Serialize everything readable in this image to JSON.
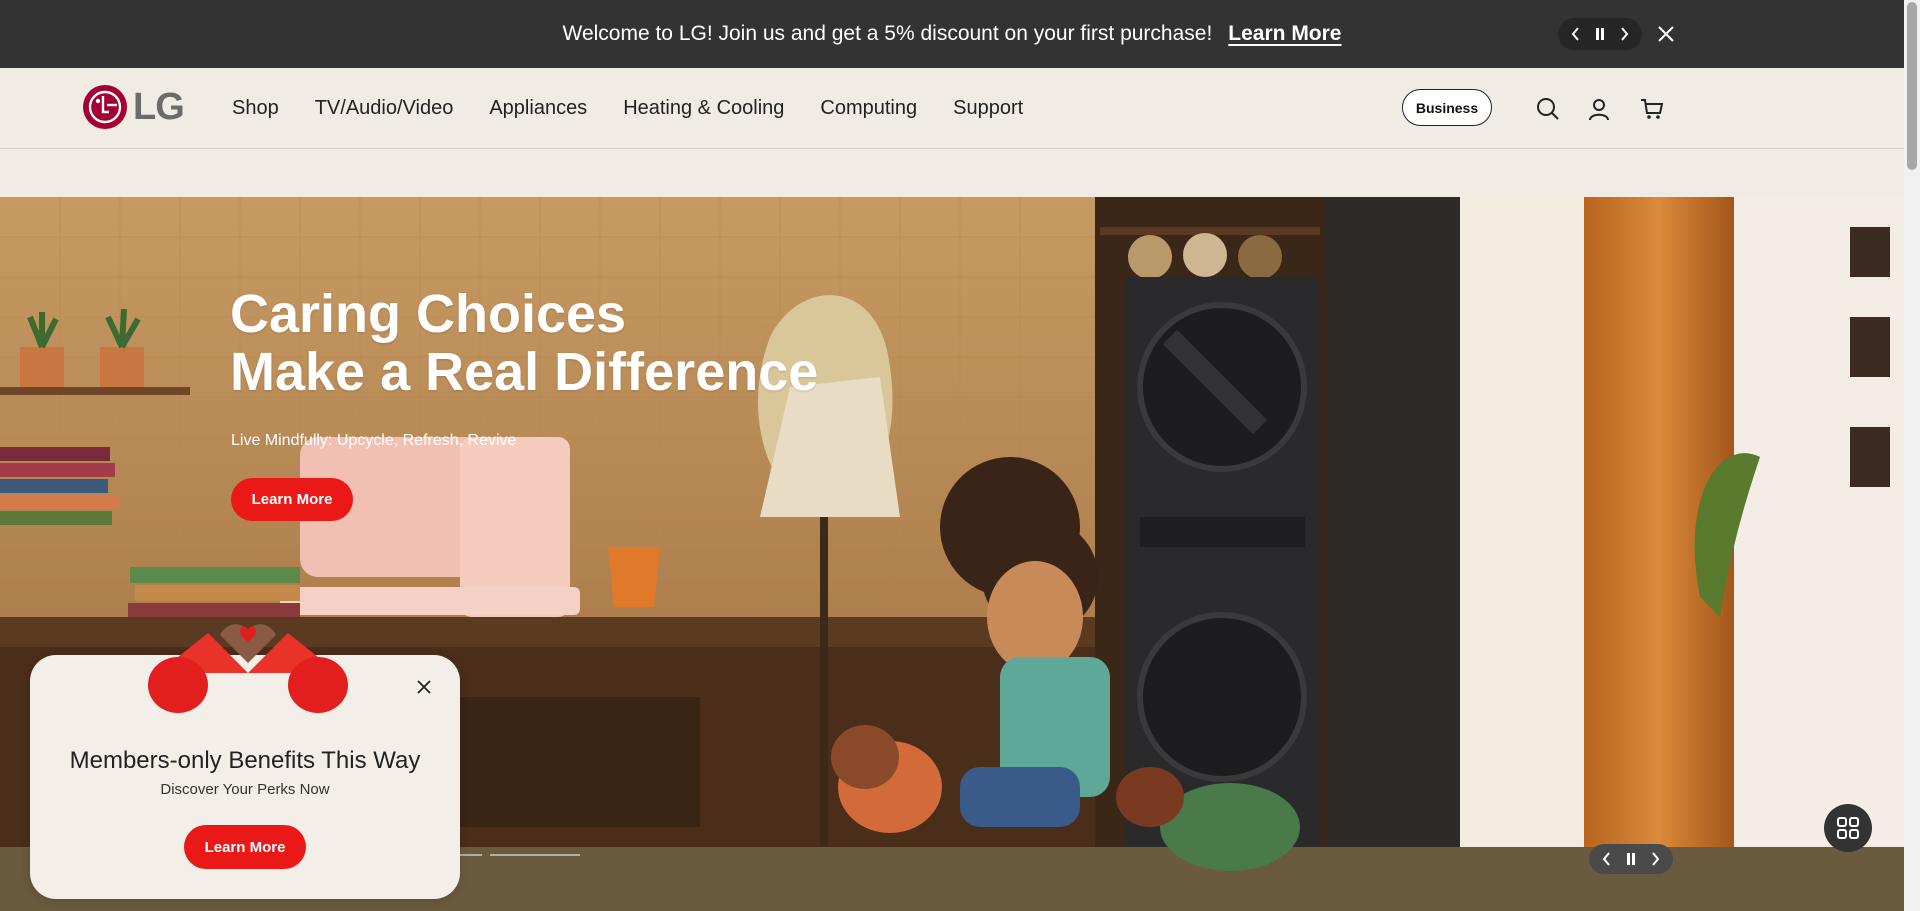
{
  "promo": {
    "message": "Welcome to LG! Join us and get a 5% discount on your first purchase!",
    "link_label": "Learn More"
  },
  "header": {
    "logo_text": "LG",
    "nav": [
      {
        "label": "Shop"
      },
      {
        "label": "TV/Audio/Video"
      },
      {
        "label": "Appliances"
      },
      {
        "label": "Heating & Cooling"
      },
      {
        "label": "Computing"
      },
      {
        "label": "Support"
      }
    ],
    "business_label": "Business",
    "icons": [
      "search-icon",
      "account-icon",
      "cart-icon"
    ]
  },
  "hero": {
    "title_line1": "Caring Choices",
    "title_line2": "Make a Real Difference",
    "subtitle": "Live Mindfully: Upcycle, Refresh, Revive",
    "cta_label": "Learn More"
  },
  "popup": {
    "title": "Members-only Benefits This Way",
    "subtitle": "Discover Your Perks Now",
    "cta_label": "Learn More"
  },
  "colors": {
    "brand_red": "#ea1917",
    "lg_magenta": "#a50034",
    "promo_bg": "#333333",
    "header_bg": "#f0ece4"
  }
}
